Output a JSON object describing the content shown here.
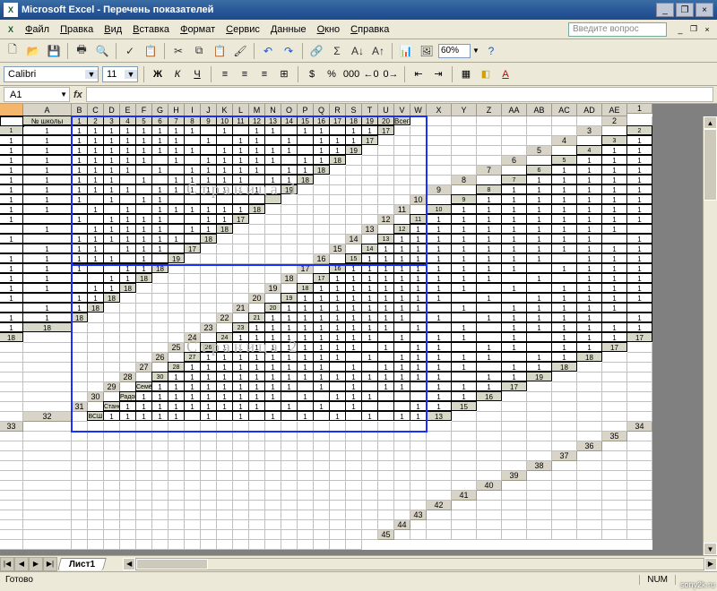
{
  "window": {
    "title": "Microsoft Excel - Перечень показателей"
  },
  "menu": [
    "Файл",
    "Правка",
    "Вид",
    "Вставка",
    "Формат",
    "Сервис",
    "Данные",
    "Окно",
    "Справка"
  ],
  "help_search_placeholder": "Введите вопрос",
  "zoom": "60%",
  "font": {
    "name": "Calibri",
    "size": "11"
  },
  "namebox": "A1",
  "columns": [
    "A",
    "B",
    "C",
    "D",
    "E",
    "F",
    "G",
    "H",
    "I",
    "J",
    "K",
    "L",
    "M",
    "N",
    "O",
    "P",
    "Q",
    "R",
    "S",
    "T",
    "U",
    "V",
    "W",
    "X",
    "Y",
    "Z",
    "AA",
    "AB",
    "AC",
    "AD",
    "AE"
  ],
  "header_row": [
    "№ школы",
    "1",
    "2",
    "3",
    "4",
    "5",
    "6",
    "7",
    "8",
    "9",
    "10",
    "11",
    "12",
    "13",
    "14",
    "15",
    "16",
    "17",
    "18",
    "19",
    "20",
    "Всего"
  ],
  "page_labels": [
    "Страница 1",
    "Страница 2"
  ],
  "rows": [
    {
      "label": "1",
      "v": [
        1,
        1,
        1,
        1,
        1,
        1,
        1,
        1,
        1,
        null,
        1,
        null,
        1,
        1,
        null,
        1,
        1,
        null,
        1,
        1
      ],
      "t": 17
    },
    {
      "label": "2",
      "v": [
        1,
        1,
        1,
        1,
        1,
        1,
        1,
        1,
        1,
        null,
        1,
        null,
        1,
        1,
        null,
        1,
        null,
        1,
        1,
        1
      ],
      "t": 17
    },
    {
      "label": "3",
      "v": [
        1,
        1,
        1,
        1,
        1,
        1,
        1,
        1,
        1,
        1,
        1,
        null,
        1,
        1,
        1,
        1,
        1,
        null,
        1,
        1
      ],
      "t": 19
    },
    {
      "label": "4",
      "v": [
        1,
        1,
        1,
        1,
        1,
        1,
        1,
        1,
        1,
        null,
        1,
        null,
        1,
        1,
        1,
        1,
        1,
        null,
        1,
        1
      ],
      "t": 18
    },
    {
      "label": "5",
      "v": [
        1,
        1,
        1,
        1,
        1,
        1,
        1,
        1,
        1,
        null,
        1,
        null,
        1,
        1,
        1,
        1,
        1,
        null,
        1,
        1
      ],
      "t": 18
    },
    {
      "label": "6",
      "v": [
        1,
        1,
        1,
        1,
        1,
        1,
        1,
        1,
        1,
        null,
        1,
        null,
        1,
        1,
        1,
        1,
        1,
        null,
        1,
        1
      ],
      "t": 18
    },
    {
      "label": "7",
      "v": [
        1,
        1,
        1,
        1,
        1,
        1,
        1,
        1,
        1,
        1,
        1,
        null,
        1,
        1,
        1,
        1,
        1,
        1,
        1,
        null
      ],
      "t": 19
    },
    {
      "label": "8",
      "v": [
        1,
        1,
        1,
        1,
        1,
        1,
        1,
        1,
        1,
        null,
        1,
        null,
        1,
        1,
        null,
        null,
        null,
        null,
        null,
        null
      ],
      "t": null
    },
    {
      "label": "9",
      "v": [
        1,
        1,
        1,
        1,
        1,
        1,
        1,
        1,
        1,
        null,
        1,
        null,
        1,
        null,
        1,
        1,
        1,
        1,
        1,
        1
      ],
      "t": 18
    },
    {
      "label": "10",
      "v": [
        1,
        1,
        1,
        1,
        1,
        1,
        1,
        1,
        1,
        null,
        1,
        null,
        1,
        1,
        1,
        1,
        null,
        null,
        1,
        1
      ],
      "t": 17
    },
    {
      "label": "11",
      "v": [
        1,
        1,
        1,
        1,
        1,
        1,
        1,
        1,
        1,
        null,
        1,
        null,
        1,
        1,
        1,
        1,
        1,
        null,
        1,
        1
      ],
      "t": 18
    },
    {
      "label": "12",
      "v": [
        1,
        1,
        1,
        1,
        1,
        1,
        1,
        1,
        1,
        null,
        1,
        null,
        1,
        1,
        1,
        1,
        1,
        1,
        1,
        null
      ],
      "t": 18
    },
    {
      "label": "13",
      "v": [
        1,
        1,
        1,
        1,
        1,
        1,
        1,
        1,
        1,
        null,
        1,
        null,
        1,
        1,
        1,
        null,
        1,
        1,
        1,
        null
      ],
      "t": 17
    },
    {
      "label": "14",
      "v": [
        1,
        1,
        1,
        1,
        1,
        1,
        1,
        1,
        1,
        1,
        1,
        1,
        1,
        1,
        1,
        1,
        1,
        null,
        1,
        null
      ],
      "t": 19
    },
    {
      "label": "15",
      "v": [
        1,
        1,
        1,
        1,
        1,
        1,
        1,
        1,
        1,
        null,
        1,
        1,
        1,
        1,
        1,
        1,
        null,
        null,
        1,
        1
      ],
      "t": 18
    },
    {
      "label": "16",
      "v": [
        1,
        1,
        1,
        1,
        1,
        1,
        1,
        1,
        1,
        null,
        1,
        1,
        1,
        1,
        1,
        1,
        null,
        null,
        1,
        1
      ],
      "t": 18
    },
    {
      "label": "17",
      "v": [
        1,
        1,
        1,
        1,
        1,
        1,
        1,
        1,
        1,
        null,
        1,
        null,
        1,
        1,
        1,
        1,
        1,
        null,
        1,
        1
      ],
      "t": 18
    },
    {
      "label": "18",
      "v": [
        1,
        1,
        1,
        1,
        1,
        1,
        1,
        1,
        1,
        null,
        1,
        null,
        1,
        1,
        1,
        1,
        1,
        null,
        1,
        1
      ],
      "t": 18
    },
    {
      "label": "19",
      "v": [
        1,
        1,
        1,
        1,
        1,
        1,
        1,
        1,
        1,
        null,
        1,
        null,
        1,
        1,
        1,
        1,
        1,
        null,
        1,
        1
      ],
      "t": 18
    },
    {
      "label": "20",
      "v": [
        1,
        1,
        1,
        1,
        1,
        1,
        1,
        1,
        1,
        null,
        1,
        null,
        1,
        1,
        1,
        1,
        1,
        null,
        1,
        1
      ],
      "t": 18
    },
    {
      "label": "21",
      "v": [
        1,
        1,
        1,
        1,
        1,
        1,
        1,
        1,
        1,
        null,
        1,
        null,
        1,
        1,
        1,
        1,
        1,
        null,
        1,
        1
      ],
      "t": 18
    },
    {
      "label": "23",
      "v": [
        1,
        1,
        1,
        1,
        1,
        1,
        1,
        1,
        1,
        null,
        1,
        null,
        1,
        null,
        1,
        1,
        1,
        1,
        1,
        1
      ],
      "t": 18
    },
    {
      "label": "24",
      "v": [
        1,
        1,
        1,
        1,
        1,
        1,
        1,
        1,
        1,
        null,
        1,
        null,
        1,
        1,
        null,
        1,
        null,
        1,
        1,
        1
      ],
      "t": 17
    },
    {
      "label": "26",
      "v": [
        1,
        1,
        1,
        1,
        1,
        1,
        1,
        1,
        1,
        null,
        1,
        null,
        1,
        1,
        null,
        1,
        1,
        null,
        1,
        1
      ],
      "t": 17
    },
    {
      "label": "27",
      "v": [
        1,
        1,
        1,
        1,
        1,
        1,
        1,
        1,
        1,
        null,
        1,
        null,
        1,
        1,
        1,
        1,
        1,
        null,
        1,
        1
      ],
      "t": 18
    },
    {
      "label": "28",
      "v": [
        1,
        1,
        1,
        1,
        1,
        1,
        1,
        1,
        1,
        null,
        1,
        null,
        1,
        1,
        1,
        1,
        1,
        null,
        1,
        1
      ],
      "t": 18
    },
    {
      "label": "30",
      "v": [
        1,
        1,
        1,
        1,
        1,
        1,
        1,
        1,
        1,
        1,
        1,
        1,
        1,
        1,
        1,
        1,
        1,
        null,
        1,
        1
      ],
      "t": 19
    },
    {
      "label": "Семёновка",
      "v": [
        1,
        1,
        1,
        1,
        1,
        1,
        1,
        1,
        1,
        null,
        1,
        null,
        1,
        null,
        1,
        1,
        null,
        1,
        1,
        1
      ],
      "t": 17
    },
    {
      "label": "Радонежск",
      "v": [
        1,
        1,
        1,
        1,
        1,
        1,
        1,
        1,
        1,
        null,
        1,
        null,
        1,
        1,
        1,
        null,
        null,
        null,
        1,
        1
      ],
      "t": 16
    },
    {
      "label": "Становление",
      "v": [
        1,
        1,
        1,
        1,
        1,
        1,
        1,
        1,
        1,
        null,
        1,
        null,
        1,
        null,
        1,
        null,
        null,
        null,
        1,
        1
      ],
      "t": 15
    },
    {
      "label": "ВСШ",
      "v": [
        1,
        1,
        1,
        1,
        1,
        null,
        1,
        null,
        1,
        null,
        1,
        null,
        1,
        null,
        1,
        null,
        1,
        null,
        1,
        1
      ],
      "t": 13
    }
  ],
  "sheet_tab": "Лист1",
  "status": "Готово",
  "status_num": "NUM",
  "watermark": "sony2k.ru"
}
